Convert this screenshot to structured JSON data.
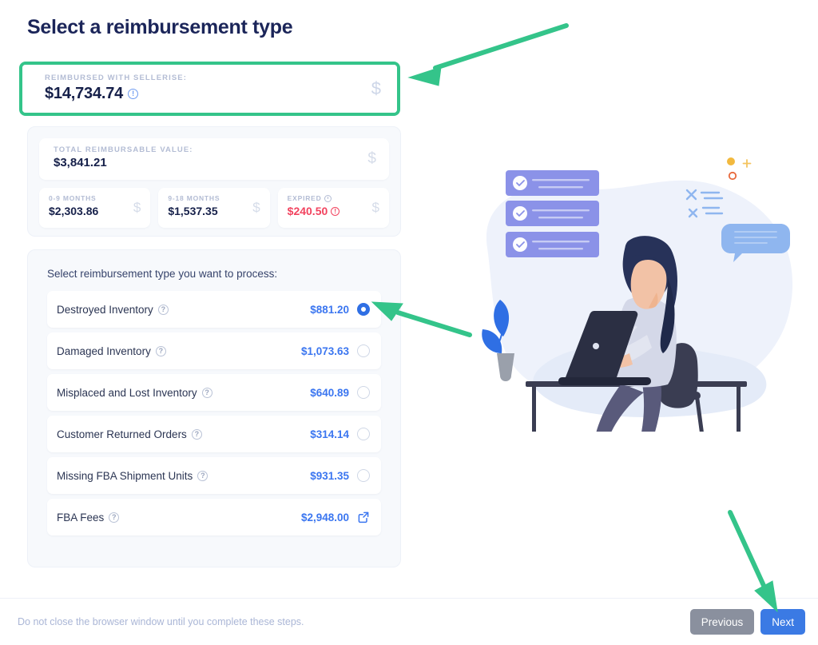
{
  "page": {
    "title": "Select a reimbursement type"
  },
  "hero": {
    "label": "REIMBURSED WITH SELLERISE:",
    "amount": "$14,734.74",
    "info_icon": "info-icon",
    "currency_icon": "dollar-sign-icon",
    "highlight_color": "#34c48a"
  },
  "summary": {
    "total": {
      "label": "TOTAL REIMBURSABLE VALUE:",
      "amount": "$3,841.21",
      "currency_icon": "dollar-sign-icon"
    },
    "buckets": [
      {
        "label": "0-9 MONTHS",
        "amount": "$2,303.86",
        "state": "normal",
        "has_clock_icon": false,
        "has_alert_icon": false
      },
      {
        "label": "9-18 MONTHS",
        "amount": "$1,537.35",
        "state": "normal",
        "has_clock_icon": false,
        "has_alert_icon": false
      },
      {
        "label": "EXPIRED",
        "amount": "$240.50",
        "state": "danger",
        "has_clock_icon": true,
        "has_alert_icon": true
      }
    ]
  },
  "selection": {
    "heading": "Select reimbursement type you want to process:",
    "options": [
      {
        "label": "Destroyed Inventory",
        "amount": "$881.20",
        "control": "radio",
        "selected": true
      },
      {
        "label": "Damaged Inventory",
        "amount": "$1,073.63",
        "control": "radio",
        "selected": false
      },
      {
        "label": "Misplaced and Lost Inventory",
        "amount": "$640.89",
        "control": "radio",
        "selected": false
      },
      {
        "label": "Customer Returned Orders",
        "amount": "$314.14",
        "control": "radio",
        "selected": false
      },
      {
        "label": "Missing FBA Shipment Units",
        "amount": "$931.35",
        "control": "radio",
        "selected": false
      },
      {
        "label": "FBA Fees",
        "amount": "$2,948.00",
        "control": "external-link",
        "selected": false
      }
    ]
  },
  "footer": {
    "note": "Do not close the browser window until you complete these steps.",
    "previous_label": "Previous",
    "next_label": "Next"
  },
  "colors": {
    "accent_blue": "#3b76f0",
    "next_button": "#3b7ae4",
    "previous_button": "#8a909e",
    "danger_red": "#f2435f",
    "annotation_green": "#34c48a",
    "card_bg": "#f7f9fc"
  }
}
